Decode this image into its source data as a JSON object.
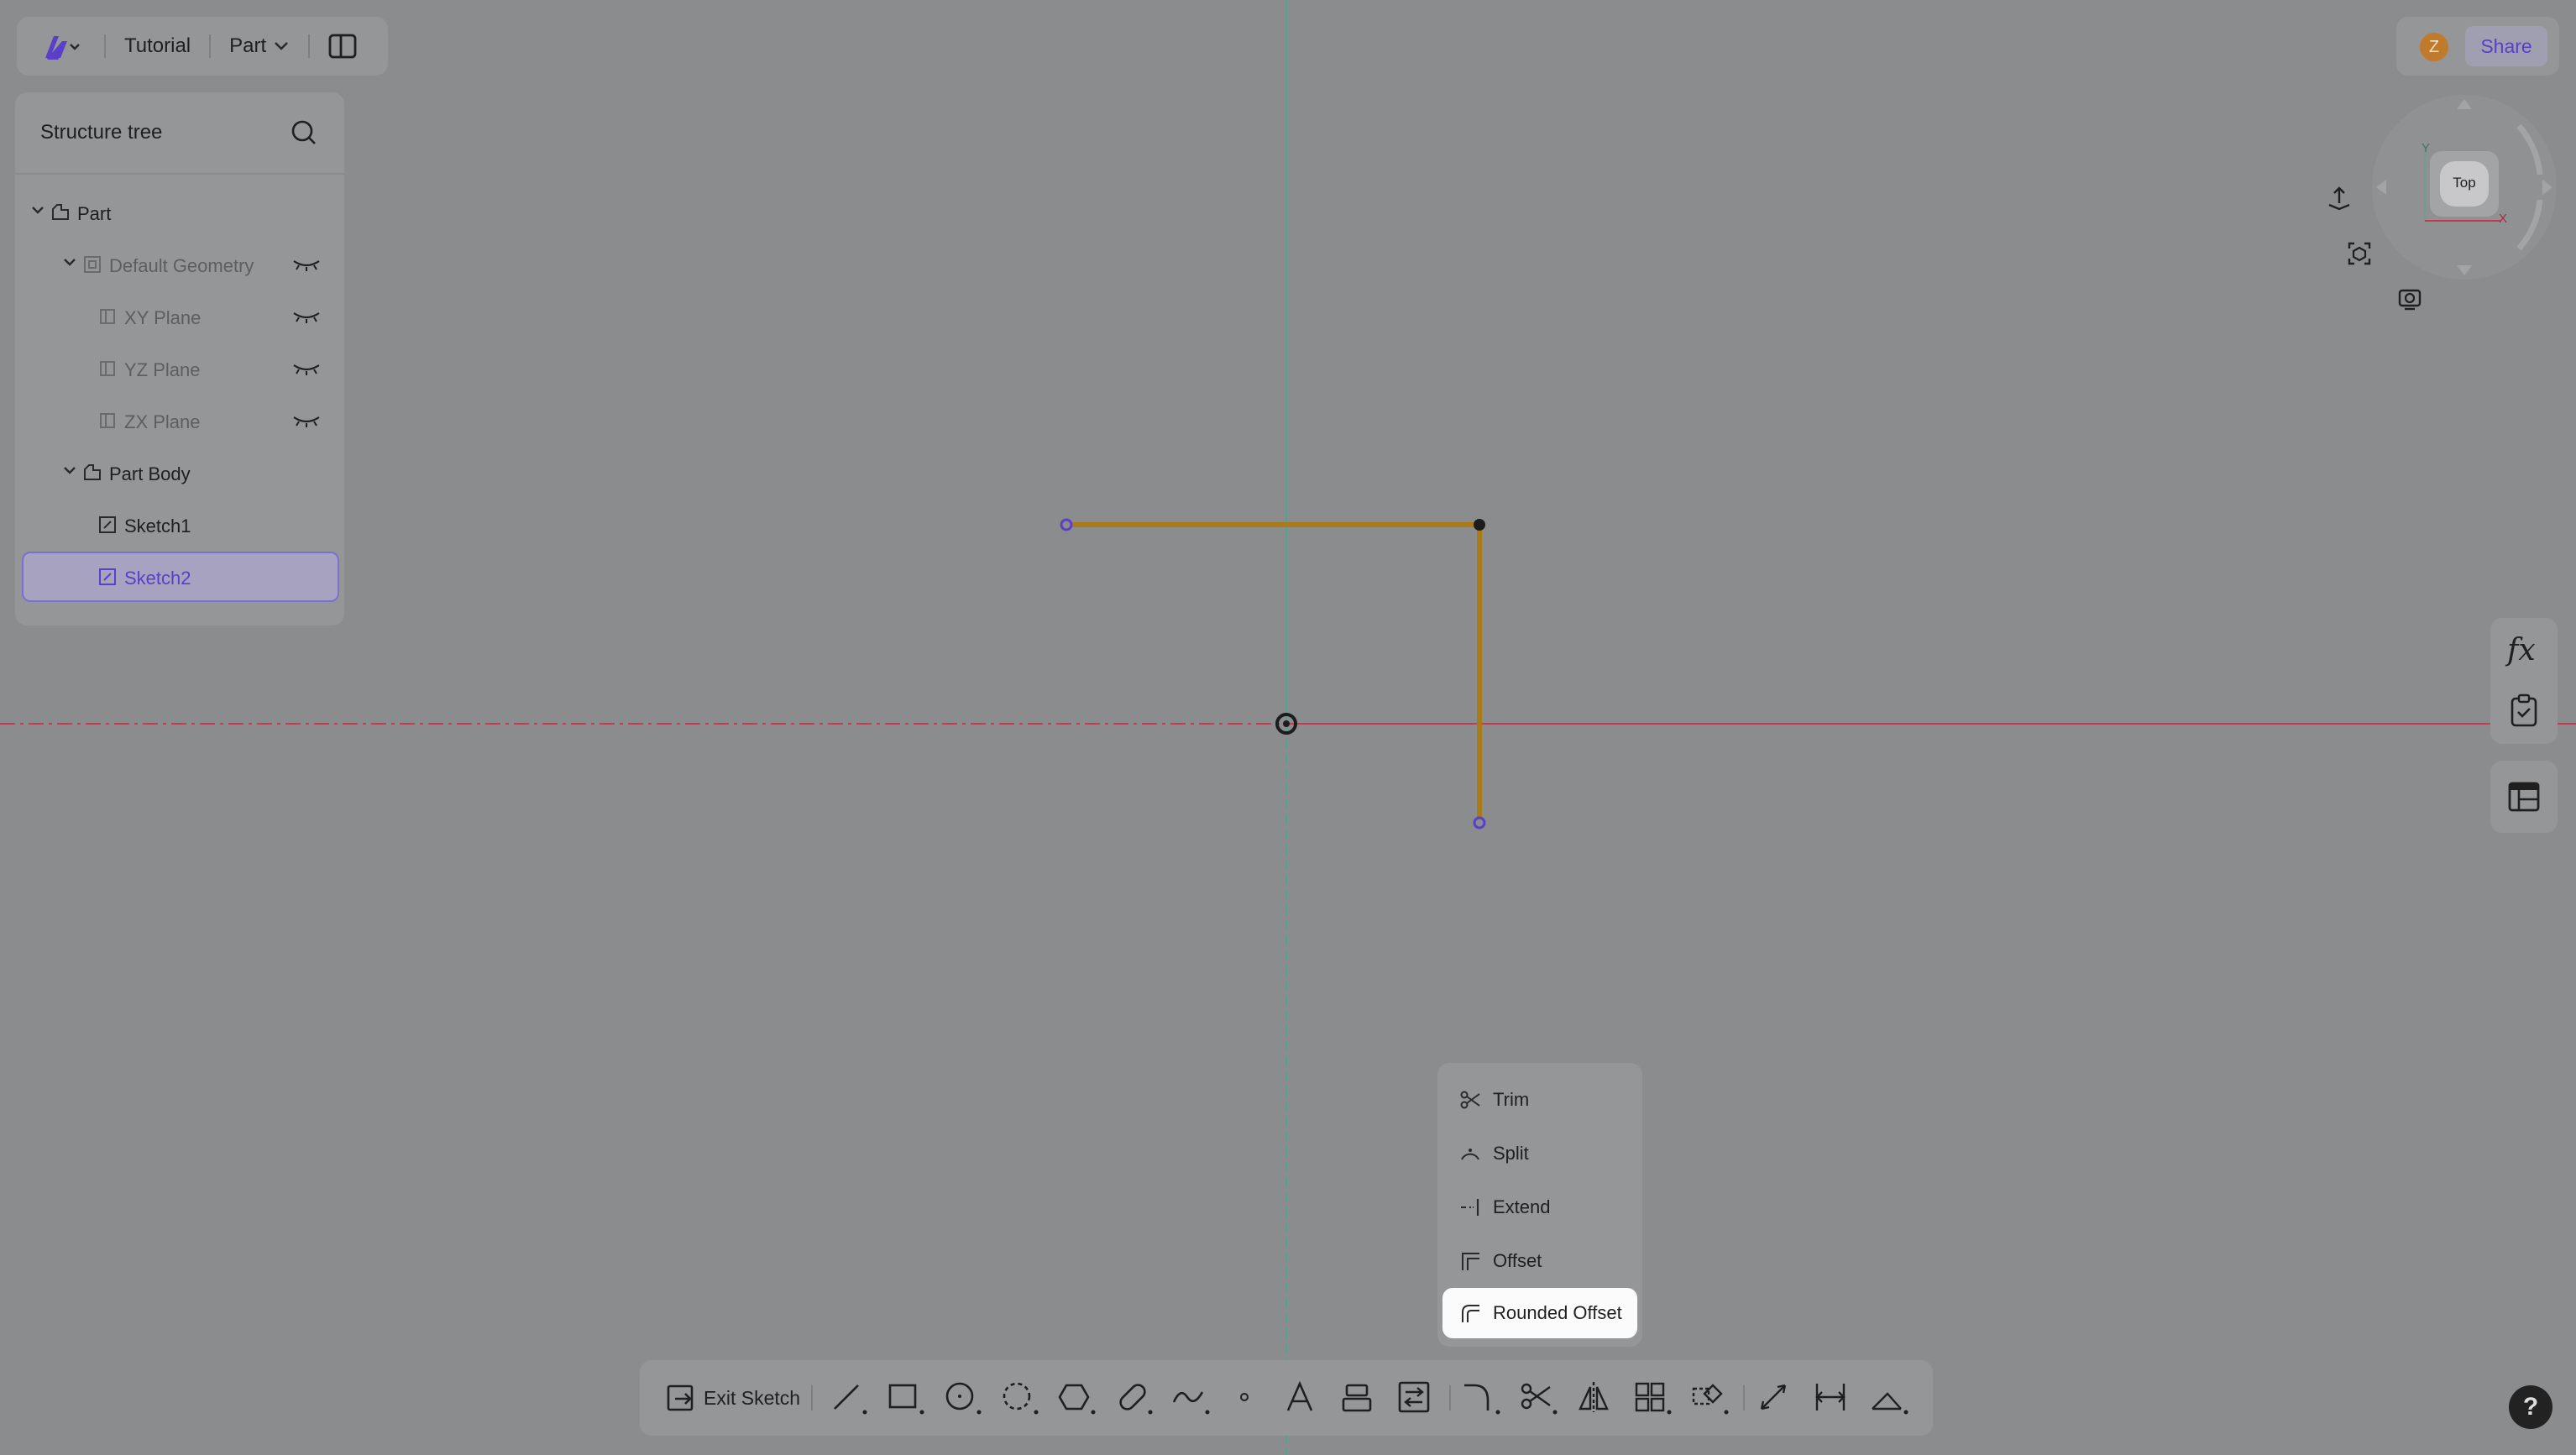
{
  "header": {
    "app_menu": "app-logo-icon",
    "document_name": "Tutorial",
    "workspace": "Part",
    "panel_toggle": "panel-toggle-icon"
  },
  "user": {
    "avatar_initial": "Z",
    "share_label": "Share"
  },
  "structure_tree": {
    "title": "Structure tree",
    "items": [
      {
        "label": "Part",
        "level": 0,
        "expanded": true
      },
      {
        "label": "Default Geometry",
        "level": 1,
        "expanded": true,
        "hidden": true
      },
      {
        "label": "XY Plane",
        "level": 2,
        "hidden": true
      },
      {
        "label": "YZ Plane",
        "level": 2,
        "hidden": true
      },
      {
        "label": "ZX Plane",
        "level": 2,
        "hidden": true
      },
      {
        "label": "Part Body",
        "level": 1,
        "expanded": true
      },
      {
        "label": "Sketch1",
        "level": 2
      },
      {
        "label": "Sketch2",
        "level": 2,
        "selected": true
      }
    ]
  },
  "view_cube": {
    "face": "Top",
    "axis_y": "Y",
    "axis_x": "X"
  },
  "modify_menu": {
    "items": [
      {
        "label": "Trim"
      },
      {
        "label": "Split"
      },
      {
        "label": "Extend"
      },
      {
        "label": "Offset"
      },
      {
        "label": "Rounded Offset",
        "active": true
      }
    ]
  },
  "toolbar": {
    "exit_sketch_label": "Exit Sketch",
    "tools": [
      "line-icon",
      "rectangle-icon",
      "circle-icon",
      "arc-icon",
      "polygon-icon",
      "slot-icon",
      "spline-icon",
      "point-icon",
      "text-icon",
      "project-icon",
      "convert-icon",
      "fillet-icon",
      "trim-icon",
      "mirror-icon",
      "pattern-icon",
      "transform-icon",
      "dimension-icon",
      "constraint-icon",
      "construction-icon"
    ]
  },
  "help_label": "?",
  "colors": {
    "sketch_line": "#a87a18",
    "vertical_axis": "#4fa592",
    "horizontal_axis": "#c23b55",
    "accent": "#5a3fc8"
  }
}
